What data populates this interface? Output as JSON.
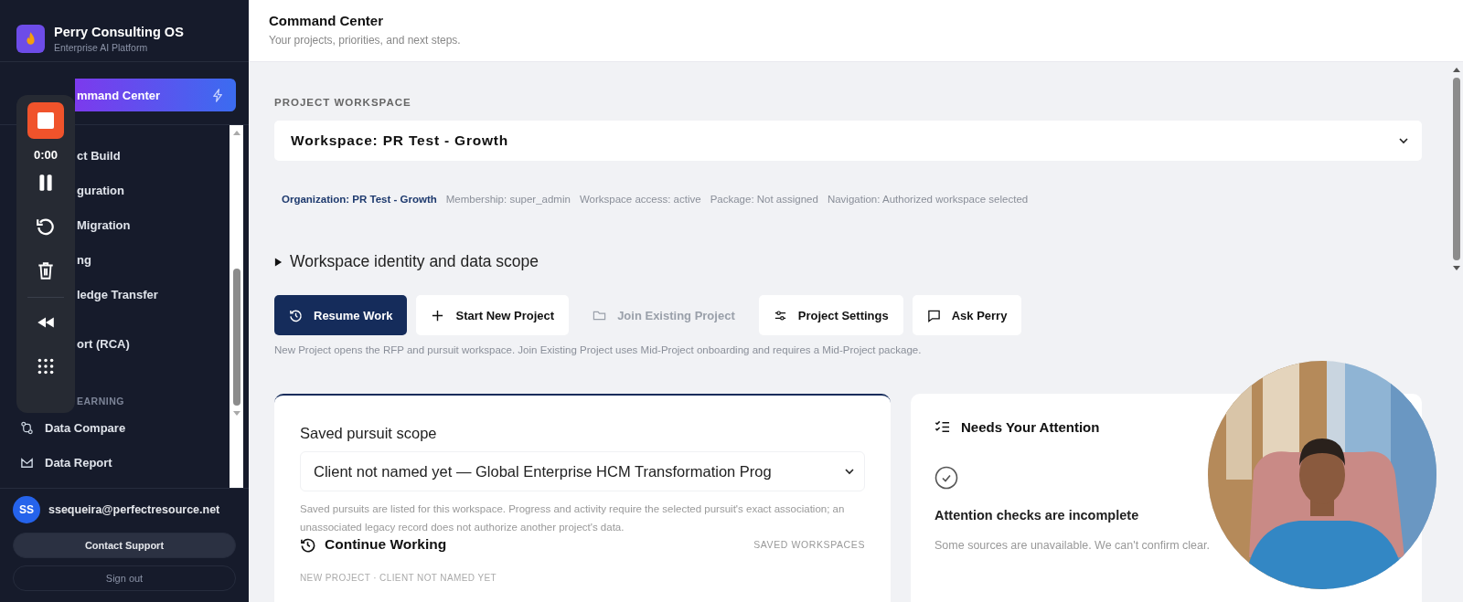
{
  "sidebar": {
    "brand": {
      "title": "Perry Consulting OS",
      "subtitle": "Enterprise AI Platform"
    },
    "active_item": {
      "label": "mmand Center",
      "selected": true
    },
    "items": [
      {
        "label": "ct Build",
        "selected": false
      },
      {
        "label": "guration",
        "selected": false
      },
      {
        "label": "Migration",
        "selected": false
      },
      {
        "label": "ng",
        "selected": false
      },
      {
        "label": "ledge Transfer",
        "selected": false
      },
      {
        "label": "ort (RCA)",
        "selected": false
      }
    ],
    "section": "EARNING",
    "section_items": [
      {
        "label": "Data Compare",
        "selected": false
      },
      {
        "label": "Data Report",
        "selected": false
      }
    ],
    "user": {
      "initials": "SS",
      "email": "ssequeira@perfectresource.net"
    },
    "buttons": [
      "Contact Support",
      "Sign out"
    ]
  },
  "recorder": {
    "time": "0:00"
  },
  "header": {
    "title": "Command Center",
    "subtitle": "Your projects, priorities, and next steps."
  },
  "workspace": {
    "label": "PROJECT WORKSPACE",
    "value": "Workspace: PR Test - Growth",
    "meta": [
      {
        "text": "Organization: PR Test - Growth",
        "emphasis": true
      },
      {
        "text": "Membership: super_admin",
        "emphasis": false
      },
      {
        "text": "Workspace access: active",
        "emphasis": false
      },
      {
        "text": "Package: Not assigned",
        "emphasis": false
      },
      {
        "text": "Navigation: Authorized workspace selected",
        "emphasis": false
      }
    ],
    "details": {
      "label": "Workspace identity and data scope",
      "expanded": false
    }
  },
  "actions": [
    {
      "label": "Resume Work",
      "kind": "primary",
      "disabled": false
    },
    {
      "label": "Start New Project",
      "kind": "plus",
      "disabled": false
    },
    {
      "label": "Join Existing Project",
      "kind": "folder",
      "disabled": true
    },
    {
      "label": "Project Settings",
      "kind": "settings",
      "disabled": false
    },
    {
      "label": "Ask Perry",
      "kind": "chat",
      "disabled": false
    }
  ],
  "actions_note": "New Project opens the RFP and pursuit workspace. Join Existing Project uses Mid-Project onboarding and requires a Mid-Project package.",
  "pursuit_card": {
    "label": "Saved pursuit scope",
    "value": "Client not named yet — Global Enterprise HCM Transformation Prog",
    "help": "Saved pursuits are listed for this workspace. Progress and activity require the selected pursuit's exact association; an unassociated legacy record does not authorize another project's data.",
    "section_title": "Continue Working",
    "section_link": "SAVED WORKSPACES",
    "item_label": "NEW PROJECT · CLIENT NOT NAMED YET"
  },
  "attention_card": {
    "title": "Needs Your Attention",
    "status_title": "Attention checks are incomplete",
    "status_text": "Some sources are unavailable. We can't confirm clear."
  }
}
